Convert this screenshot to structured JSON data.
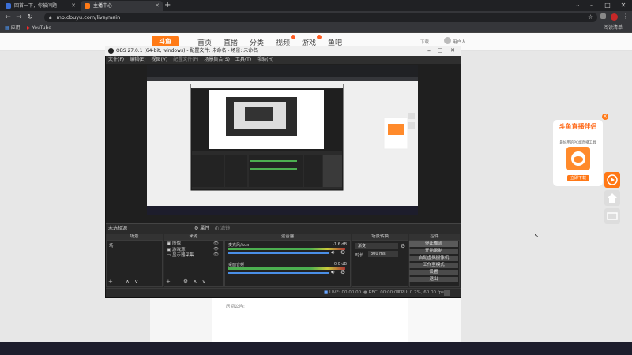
{
  "browser": {
    "tabs": [
      {
        "label": "回首一下，你被问题"
      },
      {
        "label": "主播中心"
      }
    ],
    "new_tab": "+",
    "address": "mp.douyu.com/live/main",
    "bookmarks": [
      {
        "label": "应用"
      },
      {
        "label": "YouTube"
      }
    ],
    "reading_list": "阅读清单",
    "window_controls": {
      "minimize": "–",
      "maximize": "□",
      "close": "✕"
    }
  },
  "site": {
    "logo": "斗鱼",
    "nav": [
      "首页",
      "直播",
      "分类",
      "视频",
      "游戏",
      "鱼吧"
    ],
    "header_right": {
      "download": "下载",
      "user": "用户人"
    },
    "announcement_label": "房间公告:"
  },
  "obs": {
    "title": "OBS 27.0.1 (64-bit, windows) - 配置文件: 未命名 - 场景: 未命名",
    "menu": [
      "文件(F)",
      "编辑(E)",
      "视图(V)",
      "配置文件(P)",
      "场景集合(S)",
      "工具(T)",
      "帮助(H)"
    ],
    "no_source": "未选择源",
    "props_btn": "属性",
    "filter_btn": "滤镜",
    "docks": {
      "scenes": "场景",
      "sources": "来源",
      "mixer": "混音器",
      "transitions": "场景转换",
      "controls": "控件"
    },
    "scene_list": [
      "场"
    ],
    "sources": [
      "图像",
      "游戏源",
      "显示器采集"
    ],
    "mixer_tracks": [
      {
        "name": "麦克风/Aux",
        "level": "-1.6 dB"
      },
      {
        "name": "桌面音频",
        "level": "0.0 dB"
      }
    ],
    "transition": {
      "type": "渐变",
      "duration_label": "时长",
      "duration": "300 ms"
    },
    "controls": [
      "停止推流",
      "开始录制",
      "启动虚拟摄像机",
      "工作室模式",
      "设置",
      "退出"
    ],
    "status": {
      "live": "LIVE: 00:00:00",
      "rec": "REC: 00:00:00",
      "cpu": "CPU: 0.7%, 60.00 fps"
    }
  },
  "ad": {
    "title": "斗鱼直播伴侣",
    "subtitle": "最好用的PC端直播工具",
    "button": "立即下载",
    "close": "×"
  },
  "colors": {
    "brand": "#ff7a16",
    "obs_bg": "#2b2b2b",
    "meter_green": "#4caf50",
    "meter_yellow": "#c9c93a"
  }
}
